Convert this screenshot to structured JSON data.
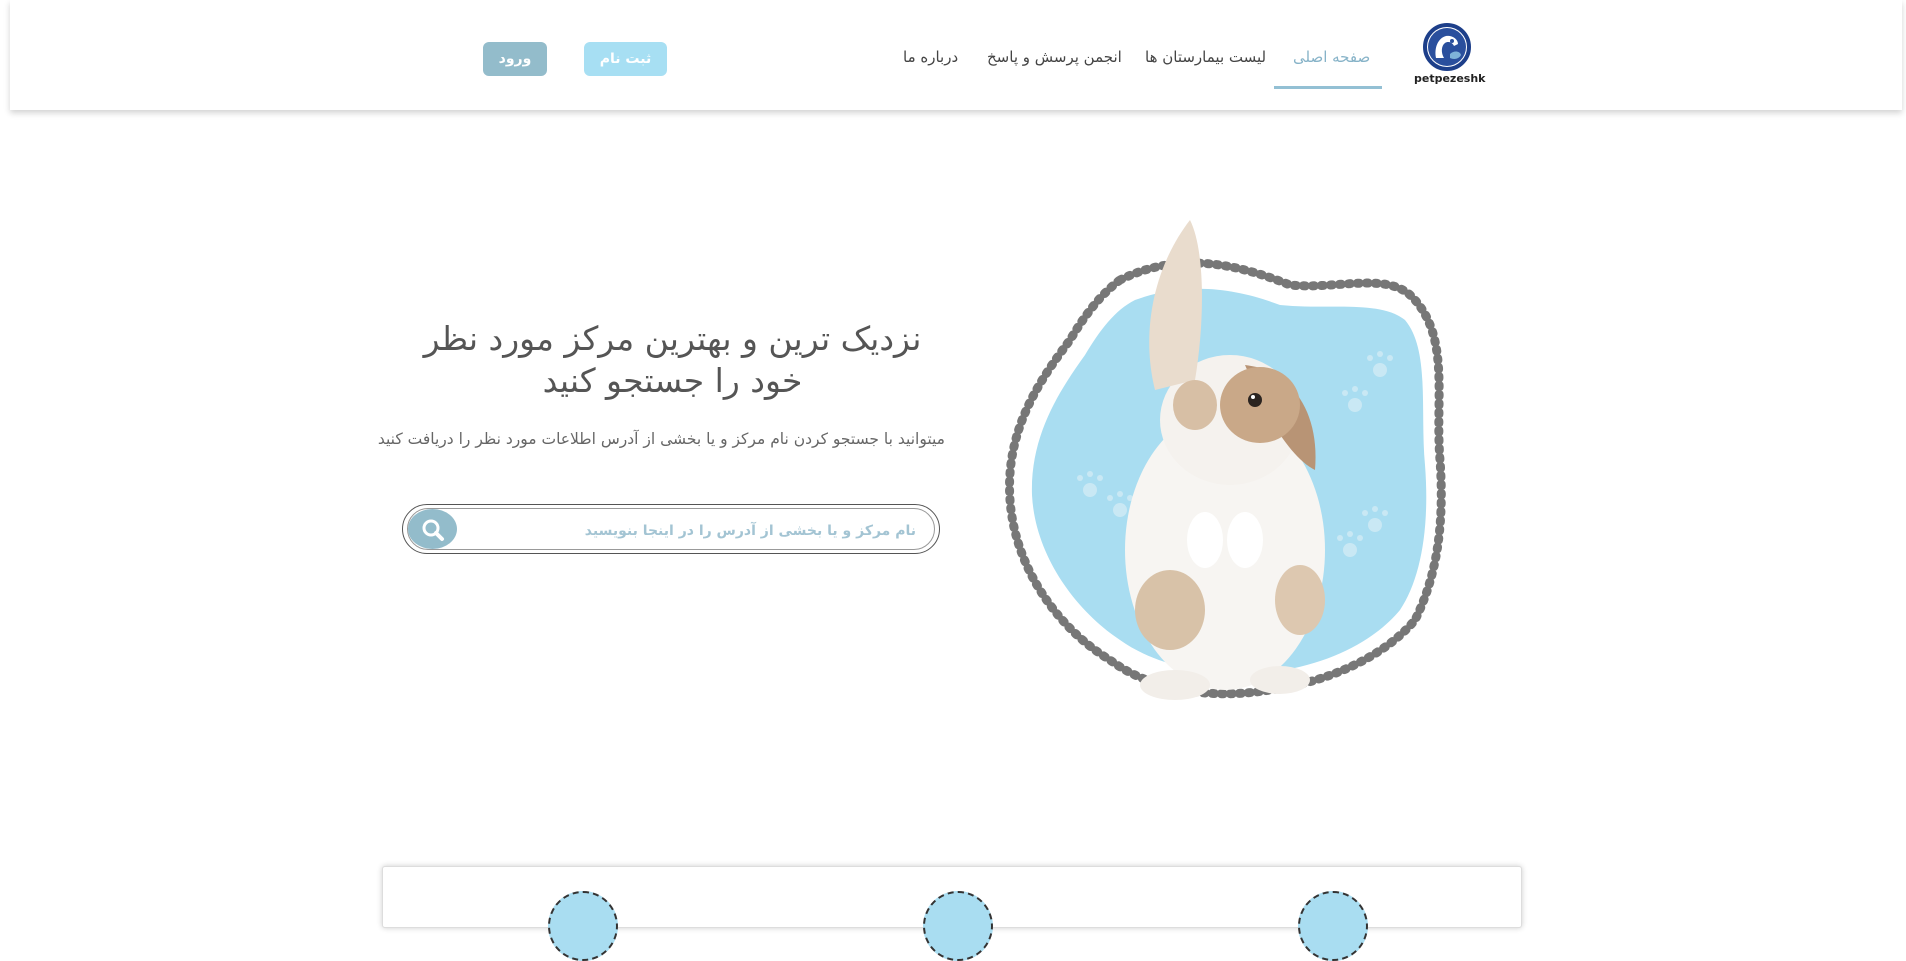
{
  "logo": {
    "text": "petpezeshk",
    "icon": "dog-cat-logo-icon"
  },
  "nav": {
    "items": [
      {
        "label": "صفحه اصلی",
        "active": true
      },
      {
        "label": "لیست بیمارستان ها",
        "active": false
      },
      {
        "label": "انجمن پرسش و پاسخ",
        "active": false
      },
      {
        "label": "درباره ما",
        "active": false
      }
    ]
  },
  "buttons": {
    "register": "ثبت نام",
    "login": "ورود"
  },
  "hero": {
    "title_line1": "نزدیک ترین و بهترین مرکز مورد نظر",
    "title_line2": "خود را جستجو کنید",
    "subtitle": "میتوانید با جستجو کردن نام مرکز و یا بخشی از آدرس اطلاعات مورد نظر را دریافت کنید",
    "search_placeholder": "نام مرکز و یا بخشی از آدرس را در اینجا بنویسید",
    "search_icon": "search-icon",
    "image": "rabbit-illustration"
  },
  "colors": {
    "accent": "#93bccb",
    "light_blue": "#a7dff3",
    "blob": "#a9ddf1",
    "text": "#555555"
  }
}
